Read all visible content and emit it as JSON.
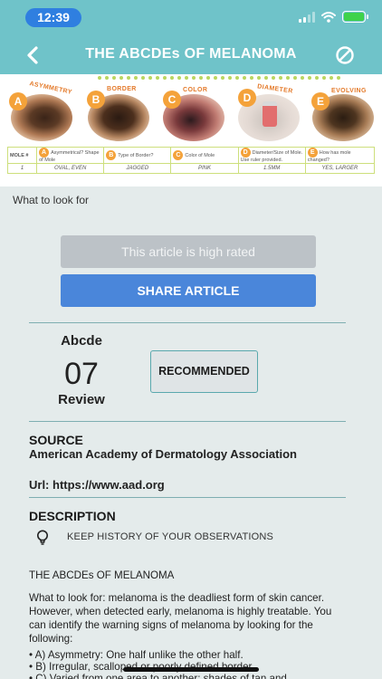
{
  "status": {
    "time": "12:39"
  },
  "header": {
    "title": "THE ABCDEs OF MELANOMA",
    "back_icon": "chevron-left-icon",
    "block_icon": "block-icon"
  },
  "hero": {
    "letters": [
      "A",
      "B",
      "C",
      "D",
      "E"
    ],
    "labels": [
      "ASYMMETRY",
      "BORDER",
      "COLOR",
      "DIAMETER",
      "EVOLVING"
    ],
    "table": {
      "head": "MOLE #",
      "cells": [
        "Asymmetrical? Shape of Mole",
        "Type of Border?",
        "Color of Mole",
        "Diameter/Size of Mole. Use ruler provided.",
        "How has mole changed?"
      ],
      "row_num": "1",
      "row": [
        "OVAL, EVEN",
        "JAGGED",
        "PINK",
        "1.5MM",
        "YES, LARGER"
      ]
    }
  },
  "caption": "What to look for",
  "buttons": {
    "rated": "This article is high rated",
    "share": "SHARE ARTICLE",
    "recommend": "RECOMMENDED"
  },
  "review": {
    "label_top": "Abcde",
    "number": "07",
    "label_bottom": "Review"
  },
  "source": {
    "heading": "SOURCE",
    "org": "American Academy of Dermatology Association",
    "url": "Url: https://www.aad.org"
  },
  "description": {
    "heading": "DESCRIPTION",
    "keep": "KEEP HISTORY OF YOUR OBSERVATIONS",
    "title": "THE ABCDEs OF MELANOMA",
    "paragraph": "What to look for: melanoma is the deadliest form of skin cancer. However, when detected early, melanoma is highly treatable. You can identify the warning signs of melanoma by looking for the following:",
    "items": [
      "• A) Asymmetry: One half unlike the other half.",
      "• B) Irregular, scalloped or poorly defined border.",
      "• C) Varied from one area to another; shades of tan and"
    ]
  },
  "colors": {
    "header": "#6fc3c9",
    "share": "#4a86da",
    "rated": "#bcc2c7",
    "accent": "#f4a23a"
  }
}
